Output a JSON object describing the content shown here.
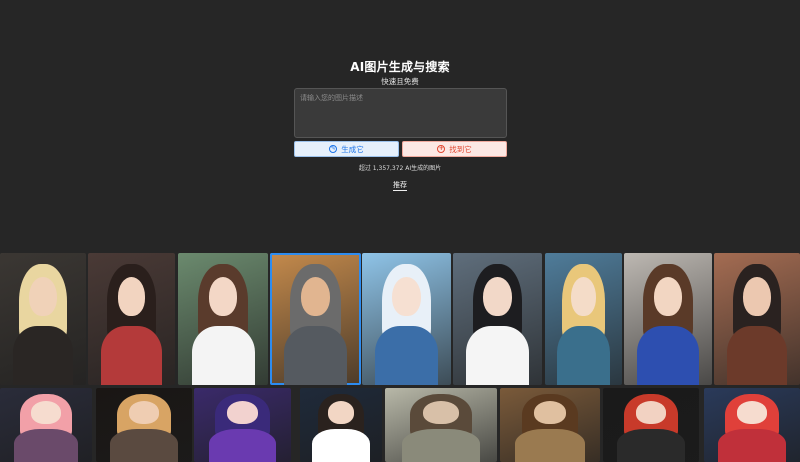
{
  "hero": {
    "title": "AI图片生成与搜索",
    "subtitle": "快速且免费",
    "prompt_placeholder": "请输入您的图片描述",
    "generate_label": "生成它",
    "find_label": "找到它",
    "stats_text": "超过 1,357,372 AI生成的图片",
    "recommend_label": "推荐"
  },
  "colors": {
    "background": "#262626",
    "generate_accent": "#1a73e8",
    "find_accent": "#e0452f",
    "selected_outline": "#2d8cf0"
  },
  "gallery": {
    "selected_index": 3,
    "row1_count": 9,
    "row2_count": 9
  }
}
